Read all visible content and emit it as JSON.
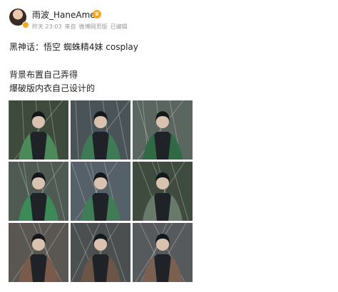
{
  "user": {
    "name": "雨波_HaneAme"
  },
  "meta": {
    "time": "昨天 23:03",
    "source_prefix": "来自",
    "source": "微博网页版",
    "edited": "已编辑"
  },
  "post": {
    "lines": [
      "黑神话：悟空 蜘蛛精4妹 cosplay",
      "背景布置自己弄得",
      "爆破版内衣自己设计的"
    ]
  },
  "photos": [
    {
      "bg": "#3d4a3c",
      "accent": "#4c8a5a"
    },
    {
      "bg": "#4a5458",
      "accent": "#3e7a55"
    },
    {
      "bg": "#5b6660",
      "accent": "#2f6a45"
    },
    {
      "bg": "#4e5a52",
      "accent": "#3b8a58"
    },
    {
      "bg": "#556068",
      "accent": "#3f7c57"
    },
    {
      "bg": "#3f4b3f",
      "accent": "#6a7a6a"
    },
    {
      "bg": "#5a5652",
      "accent": "#7a5a4a"
    },
    {
      "bg": "#4b4f50",
      "accent": "#6a5548"
    },
    {
      "bg": "#565a5c",
      "accent": "#7a6050"
    }
  ]
}
